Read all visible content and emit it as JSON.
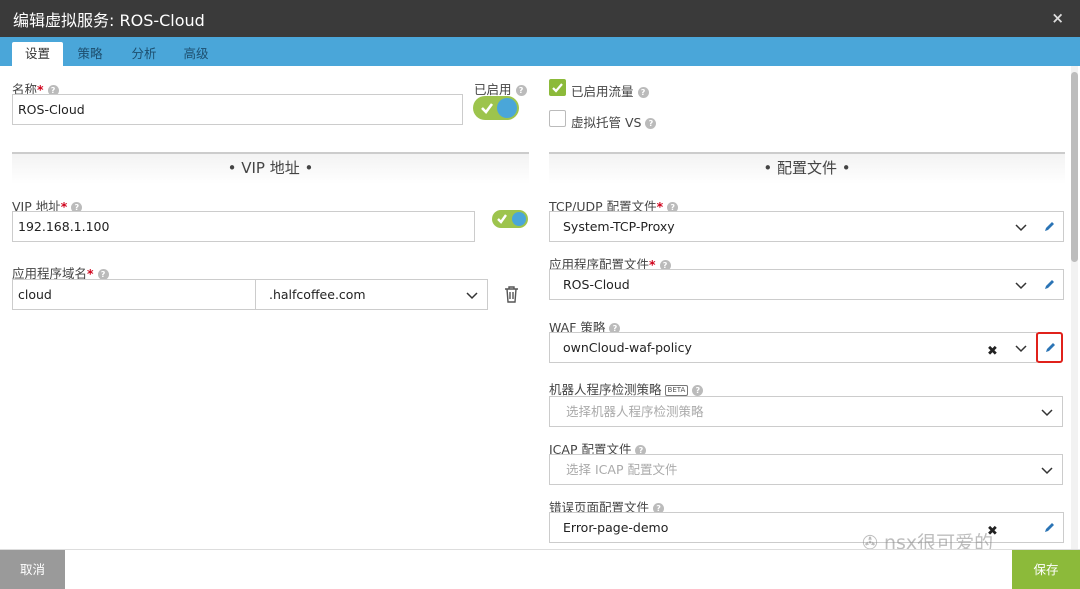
{
  "window": {
    "title": "编辑虚拟服务: ROS-Cloud",
    "close_icon": "×"
  },
  "tabs": [
    {
      "label": "设置",
      "active": true
    },
    {
      "label": "策略",
      "active": false
    },
    {
      "label": "分析",
      "active": false
    },
    {
      "label": "高级",
      "active": false
    }
  ],
  "left": {
    "name_label": "名称",
    "name_value": "ROS-Cloud",
    "enabled_label": "已启用",
    "vip_section": "• VIP 地址 •",
    "vip_label": "VIP 地址",
    "vip_value": "192.168.1.100",
    "domain_label": "应用程序域名",
    "domain_value": "cloud",
    "domain_suffix": ".halfcoffee.com"
  },
  "right": {
    "traffic_enabled_label": "已启用流量",
    "traffic_enabled": true,
    "vs_hosted_label": "虚拟托管 VS",
    "vs_hosted": false,
    "profile_section": "• 配置文件 •",
    "tcp_label": "TCP/UDP 配置文件",
    "tcp_value": "System-TCP-Proxy",
    "app_profile_label": "应用程序配置文件",
    "app_profile_value": "ROS-Cloud",
    "waf_label": "WAF 策略",
    "waf_value": "ownCloud-waf-policy",
    "bot_label": "机器人程序检测策略",
    "bot_badge": "BETA",
    "bot_placeholder": "选择机器人程序检测策略",
    "icap_label": "ICAP 配置文件",
    "icap_placeholder": "选择 ICAP 配置文件",
    "error_label": "错误页面配置文件",
    "error_value": "Error-page-demo"
  },
  "footer": {
    "cancel": "取消",
    "save": "保存"
  },
  "watermark": "nsx很可爱的",
  "colors": {
    "header": "#3a3a3a",
    "tabbar": "#4aa6d9",
    "accent_green": "#8cba3a",
    "highlight": "#e0211b"
  }
}
